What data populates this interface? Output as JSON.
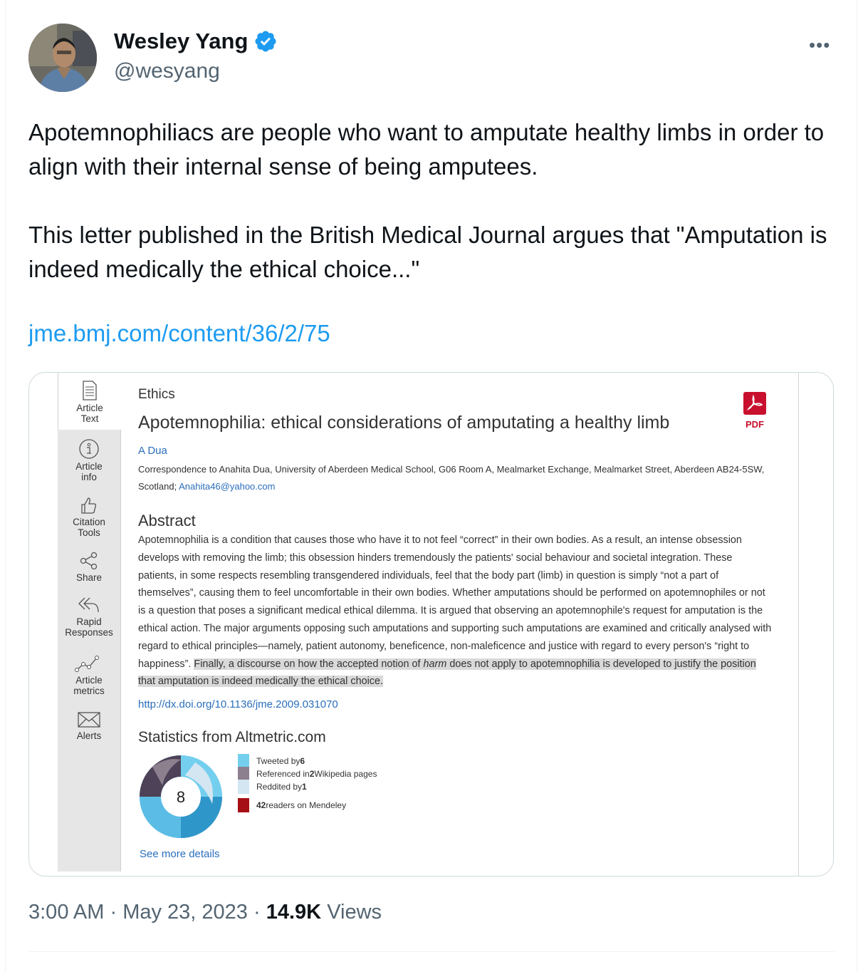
{
  "tweet": {
    "author_name": "Wesley Yang",
    "author_handle": "@wesyang",
    "more_label": "•••",
    "paragraph1": "Apotemnophiliacs are people who want to amputate healthy limbs in order to align with their internal sense of being amputees.",
    "paragraph2": "This letter published in the British Medical Journal argues that \"Amputation is indeed medically the ethical choice...\"",
    "link": "jme.bmj.com/content/36/2/75",
    "time": "3:00 AM",
    "date": "May 23, 2023",
    "views_count": "14.9K",
    "views_label": "Views",
    "separator": "·"
  },
  "card": {
    "sidebar": [
      {
        "line1": "Article",
        "line2": "Text"
      },
      {
        "line1": "Article",
        "line2": "info"
      },
      {
        "line1": "Citation",
        "line2": "Tools"
      },
      {
        "line1": "Share",
        "line2": ""
      },
      {
        "line1": "Rapid",
        "line2": "Responses"
      },
      {
        "line1": "Article",
        "line2": "metrics"
      },
      {
        "line1": "Alerts",
        "line2": ""
      }
    ],
    "section": "Ethics",
    "title": "Apotemnophilia: ethical considerations of amputating a healthy limb",
    "pdf_label": "PDF",
    "author": "A Dua",
    "correspondence": "Correspondence to Anahita Dua, University of Aberdeen Medical School, G06 Room A, Mealmarket Exchange, Mealmarket Street, Aberdeen AB24-5SW, Scotland;",
    "email": "Anahita46@yahoo.com",
    "abstract_heading": "Abstract",
    "abstract_plain": "Apotemnophilia is a condition that causes those who have it to not feel “correct” in their own bodies. As a result, an intense obsession develops with removing the limb; this obsession hinders tremendously the patients' social behaviour and societal integration. These patients, in some respects resembling transgendered individuals, feel that the body part (limb) in question is simply “not a part of themselves”, causing them to feel uncomfortable in their own bodies. Whether amputations should be performed on apotemnophiles or not is a question that poses a significant medical ethical dilemma. It is argued that observing an apotemnophile's request for amputation is the ethical action. The major arguments opposing such amputations and supporting such amputations are examined and critically analysed with regard to ethical principles—namely, patient autonomy, beneficence, non-maleficence and justice with regard to every person's “right to happiness”. ",
    "abstract_hl_start": "Finally, a discourse on how the accepted notion of ",
    "abstract_hl_em": "harm",
    "abstract_hl_end": " does not apply to apotemnophilia is developed to justify the position that amputation is indeed medically the ethical choice.",
    "doi": "http://dx.doi.org/10.1136/jme.2009.031070",
    "stats_heading": "Statistics from Altmetric.com",
    "altmetric_score": "8",
    "legend": [
      {
        "pre": "Tweeted by ",
        "num": "6",
        "post": "",
        "color": "#74cfee"
      },
      {
        "pre": "Referenced in ",
        "num": "2",
        "post": " Wikipedia pages",
        "color": "#8c7f8e"
      },
      {
        "pre": "Reddited by ",
        "num": "1",
        "post": "",
        "color": "#d3e6f2"
      },
      {
        "pre": "",
        "num": "42",
        "post": " readers on Mendeley",
        "color": "#a50f15"
      }
    ],
    "see_more": "See more details"
  },
  "colors": {
    "link_blue": "#1d9bf0",
    "verified_blue": "#1d9bf0",
    "bmj_blue": "#2a6ebb",
    "pdf_red": "#c8102e"
  }
}
